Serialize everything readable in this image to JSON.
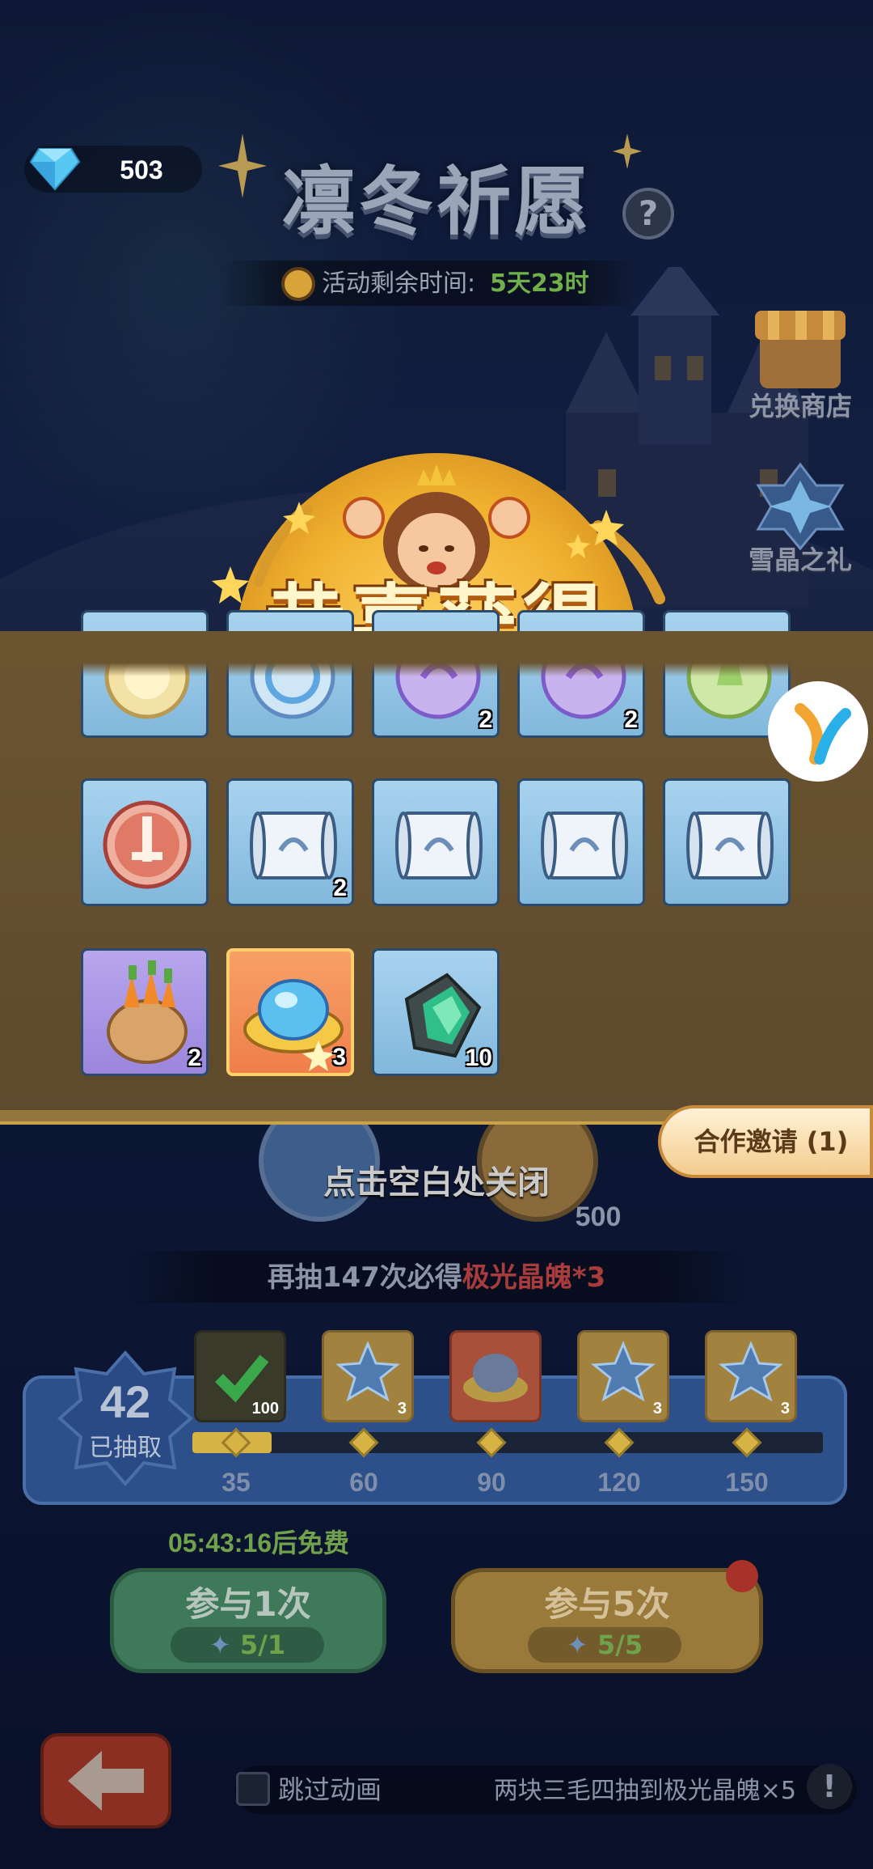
{
  "header": {
    "gem_count": "503",
    "title": "凛冬祈愿",
    "help_symbol": "?",
    "time_label": "活动剩余时间:",
    "time_value": "5天23时"
  },
  "side": {
    "shop_label": "兑换商店",
    "gift_label": "雪晶之礼"
  },
  "reward": {
    "banner": "恭喜获得",
    "close_hint": "点击空白处关闭",
    "items_row1": [
      {
        "icon": "cream-orb-icon",
        "qty": ""
      },
      {
        "icon": "blue-swirl-orb-icon",
        "qty": ""
      },
      {
        "icon": "purple-orb-icon",
        "qty": "2"
      },
      {
        "icon": "purple-orb-icon",
        "qty": "2"
      },
      {
        "icon": "green-orb-icon",
        "qty": ""
      }
    ],
    "items_row2": [
      {
        "icon": "red-sword-orb-icon",
        "qty": ""
      },
      {
        "icon": "scroll-icon",
        "qty": "2"
      },
      {
        "icon": "scroll-icon",
        "qty": ""
      },
      {
        "icon": "scroll-icon",
        "qty": ""
      },
      {
        "icon": "scroll-icon",
        "qty": ""
      }
    ],
    "items_row3": [
      {
        "icon": "carrot-sack-icon",
        "qty": "2"
      },
      {
        "icon": "aurora-crystal-icon",
        "qty": "3"
      },
      {
        "icon": "emerald-ore-icon",
        "qty": "10"
      }
    ]
  },
  "cost_coin_value": "500",
  "pity": {
    "prefix": "再抽147次必得",
    "highlight": "极光晶魄*3"
  },
  "progress": {
    "count": "42",
    "count_label": "已抽取",
    "value": 42,
    "milestones": [
      {
        "label": "35",
        "reward_qty": "100",
        "icon": "check-icon"
      },
      {
        "label": "60",
        "reward_qty": "3",
        "icon": "snowflake-icon"
      },
      {
        "label": "90",
        "reward_qty": "",
        "icon": "aurora-crystal-icon"
      },
      {
        "label": "120",
        "reward_qty": "3",
        "icon": "snowflake-icon"
      },
      {
        "label": "150",
        "reward_qty": "3",
        "icon": "snowflake-icon"
      }
    ]
  },
  "draw": {
    "free_timer": "05:43:16后免费",
    "draw1_label": "参与1次",
    "draw1_cost": "5/1",
    "draw5_label": "参与5次",
    "draw5_cost": "5/5"
  },
  "footer": {
    "skip_label": "跳过动画",
    "promo_text": "两块三毛四抽到极光晶魄×5",
    "promo_icon": "!"
  },
  "invite": {
    "label": "合作邀请 (1)"
  },
  "colors": {
    "panel": "#5d4a2c",
    "cell_blue": "#a8d3ef",
    "cell_purple": "#b8a6ee",
    "cell_orange": "#f7a067",
    "accent_gold": "#d6b344",
    "timer_green": "#6fb04a",
    "pity_red": "#a83b3b"
  }
}
